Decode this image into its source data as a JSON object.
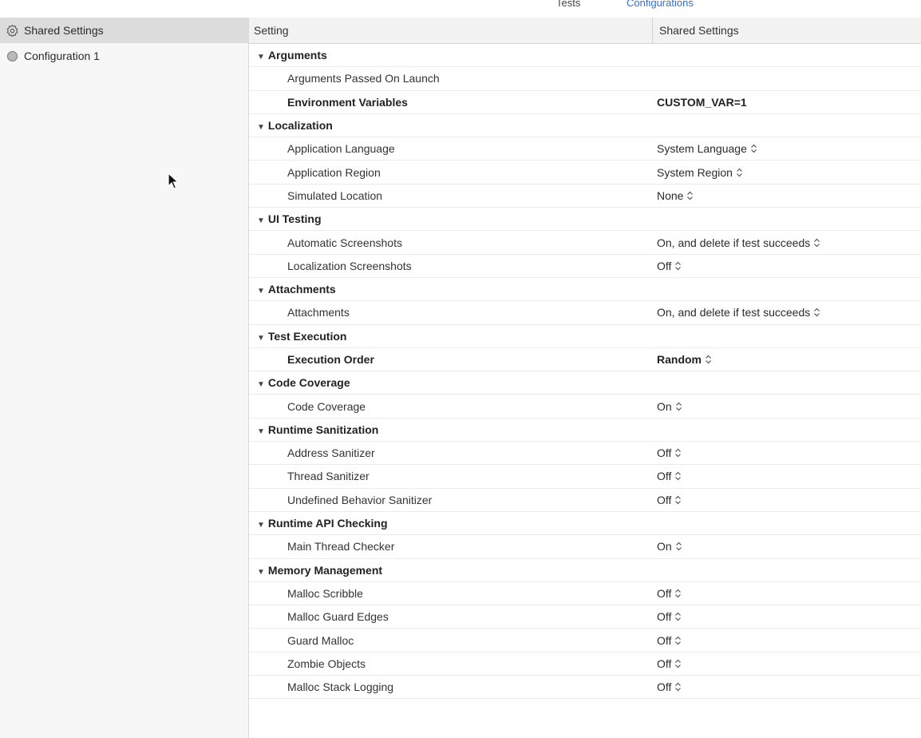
{
  "top_tabs": {
    "tests": "Tests",
    "configurations": "Configurations"
  },
  "accent_color": "#2e6fd6",
  "sidebar": {
    "items": [
      {
        "label": "Shared Settings",
        "icon": "gear-icon",
        "selected": true
      },
      {
        "label": "Configuration 1",
        "icon": "configuration-icon",
        "selected": false
      }
    ]
  },
  "table": {
    "columns": {
      "setting": "Setting",
      "shared": "Shared Settings"
    },
    "rows": [
      {
        "type": "section",
        "name": "Arguments",
        "value": ""
      },
      {
        "type": "item",
        "name": "Arguments Passed On Launch",
        "value": "",
        "stepper": false,
        "bold": false
      },
      {
        "type": "item",
        "name": "Environment Variables",
        "value": "CUSTOM_VAR=1",
        "stepper": false,
        "bold": true
      },
      {
        "type": "section",
        "name": "Localization",
        "value": ""
      },
      {
        "type": "item",
        "name": "Application Language",
        "value": "System Language",
        "stepper": true,
        "bold": false
      },
      {
        "type": "item",
        "name": "Application Region",
        "value": "System Region",
        "stepper": true,
        "bold": false
      },
      {
        "type": "item",
        "name": "Simulated Location",
        "value": "None",
        "stepper": true,
        "bold": false
      },
      {
        "type": "section",
        "name": "UI Testing",
        "value": ""
      },
      {
        "type": "item",
        "name": "Automatic Screenshots",
        "value": "On, and delete if test succeeds",
        "stepper": true,
        "bold": false
      },
      {
        "type": "item",
        "name": "Localization Screenshots",
        "value": "Off",
        "stepper": true,
        "bold": false
      },
      {
        "type": "section",
        "name": "Attachments",
        "value": ""
      },
      {
        "type": "item",
        "name": "Attachments",
        "value": "On, and delete if test succeeds",
        "stepper": true,
        "bold": false
      },
      {
        "type": "section",
        "name": "Test Execution",
        "value": ""
      },
      {
        "type": "item",
        "name": "Execution Order",
        "value": "Random",
        "stepper": true,
        "bold": true
      },
      {
        "type": "section",
        "name": "Code Coverage",
        "value": ""
      },
      {
        "type": "item",
        "name": "Code Coverage",
        "value": "On",
        "stepper": true,
        "bold": false
      },
      {
        "type": "section",
        "name": "Runtime Sanitization",
        "value": ""
      },
      {
        "type": "item",
        "name": "Address Sanitizer",
        "value": "Off",
        "stepper": true,
        "bold": false
      },
      {
        "type": "item",
        "name": "Thread Sanitizer",
        "value": "Off",
        "stepper": true,
        "bold": false
      },
      {
        "type": "item",
        "name": "Undefined Behavior Sanitizer",
        "value": "Off",
        "stepper": true,
        "bold": false
      },
      {
        "type": "section",
        "name": "Runtime API Checking",
        "value": ""
      },
      {
        "type": "item",
        "name": "Main Thread Checker",
        "value": "On",
        "stepper": true,
        "bold": false
      },
      {
        "type": "section",
        "name": "Memory Management",
        "value": ""
      },
      {
        "type": "item",
        "name": "Malloc Scribble",
        "value": "Off",
        "stepper": true,
        "bold": false
      },
      {
        "type": "item",
        "name": "Malloc Guard Edges",
        "value": "Off",
        "stepper": true,
        "bold": false
      },
      {
        "type": "item",
        "name": "Guard Malloc",
        "value": "Off",
        "stepper": true,
        "bold": false
      },
      {
        "type": "item",
        "name": "Zombie Objects",
        "value": "Off",
        "stepper": true,
        "bold": false
      },
      {
        "type": "item",
        "name": "Malloc Stack Logging",
        "value": "Off",
        "stepper": true,
        "bold": false
      }
    ]
  }
}
